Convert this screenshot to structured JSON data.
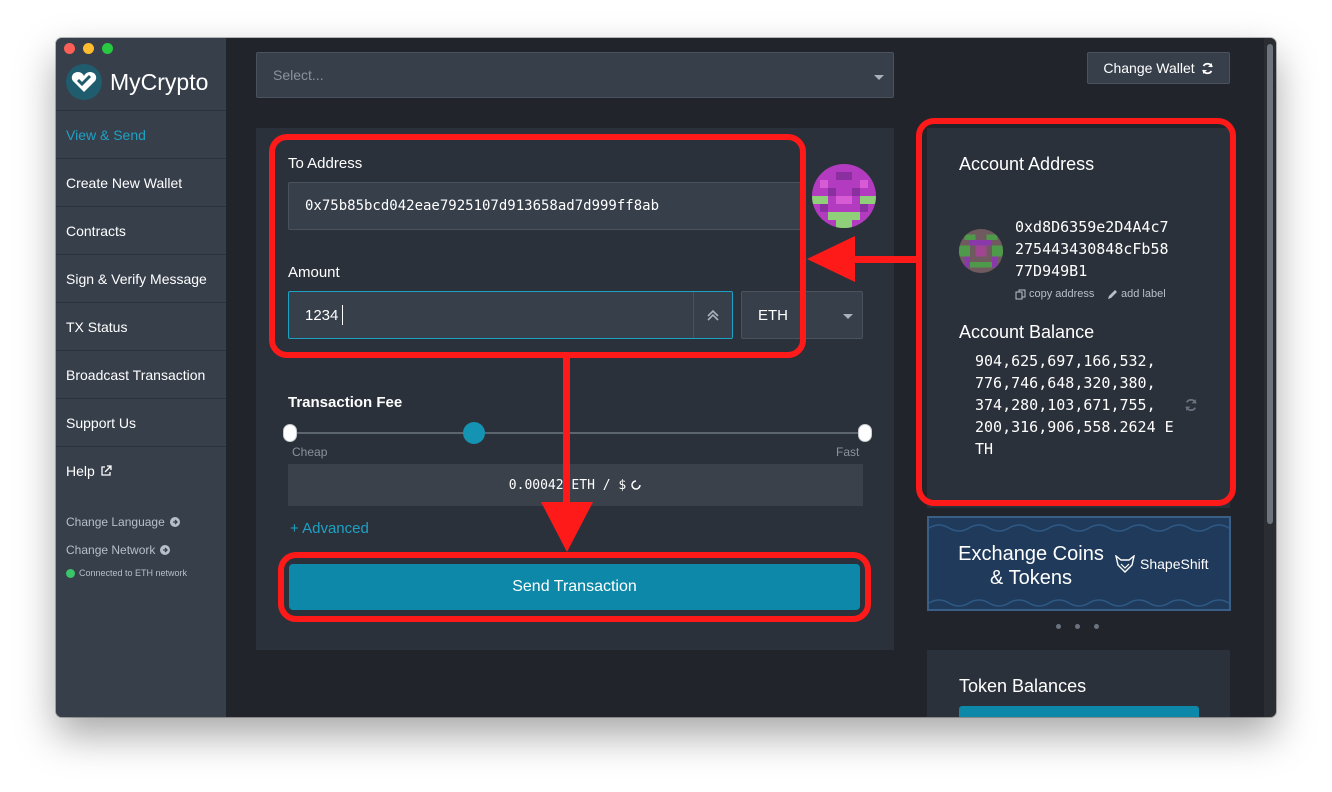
{
  "window": {
    "title_controls": [
      "close",
      "minimize",
      "zoom"
    ]
  },
  "sidebar": {
    "logo_text": "MyCrypto",
    "items": [
      {
        "label": "View & Send",
        "active": true
      },
      {
        "label": "Create New Wallet"
      },
      {
        "label": "Contracts"
      },
      {
        "label": "Sign & Verify Message"
      },
      {
        "label": "TX Status"
      },
      {
        "label": "Broadcast Transaction"
      },
      {
        "label": "Support Us"
      },
      {
        "label": "Help",
        "icon": "external-link-icon"
      }
    ],
    "change_language": "Change Language",
    "change_network": "Change Network",
    "network_status": "Connected to ETH network"
  },
  "topbar": {
    "select_placeholder": "Select...",
    "change_wallet": "Change Wallet"
  },
  "send_form": {
    "to_address_label": "To Address",
    "to_address_value": "0x75b85bcd042eae7925107d913658ad7d999ff8ab",
    "amount_label": "Amount",
    "amount_value": "1234",
    "unit": "ETH",
    "fee_label": "Transaction Fee",
    "fee_cheap": "Cheap",
    "fee_fast": "Fast",
    "fee_position": 0.32,
    "fee_display": "0.00042 ETH / $",
    "advanced": "+ Advanced",
    "send_button": "Send Transaction"
  },
  "account": {
    "address_title": "Account Address",
    "address": "0xd8D6359e2D4A4c7\n275443430848cFb58\n77D949B1",
    "copy_address": "copy address",
    "add_label": "add label",
    "balance_title": "Account Balance",
    "balance": "904,625,697,166,532,\n776,746,648,320,380,\n374,280,103,671,755,\n200,316,906,558.2624 E\nTH"
  },
  "promo": {
    "line1": "Exchange Coins",
    "line2": "& Tokens",
    "brand": "ShapeShift"
  },
  "tokens": {
    "title": "Token Balances"
  },
  "colors": {
    "accent": "#1ea1c4",
    "primary_button": "#0e88a8",
    "annotation": "#ff1a1a",
    "sidebar_bg": "#373f4b",
    "main_bg": "#21252b"
  }
}
